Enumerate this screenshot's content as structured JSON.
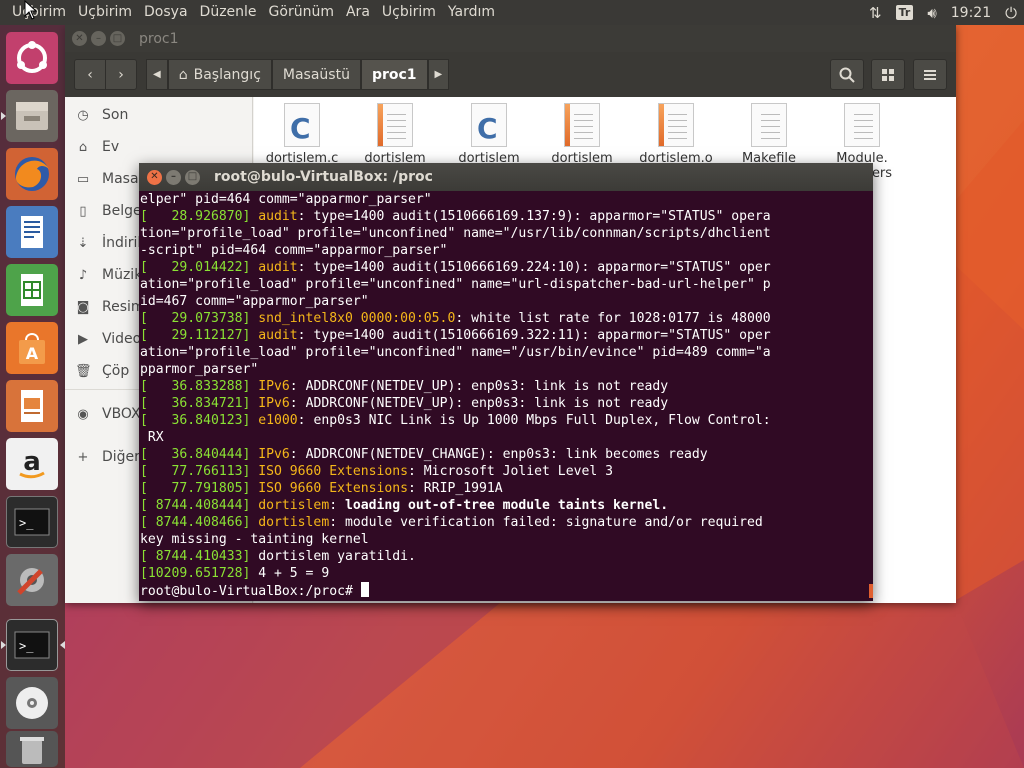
{
  "topbar": {
    "menu": [
      "Uçbirim",
      "Uçbirim",
      "Dosya",
      "Düzenle",
      "Görünüm",
      "Ara",
      "Uçbirim",
      "Yardım"
    ],
    "keyboard_layout": "Tr",
    "clock": "19:21"
  },
  "launcher": {
    "items": [
      "ubuntu-dash-icon",
      "files-icon",
      "firefox-icon",
      "writer-icon",
      "calc-icon",
      "software-center-icon",
      "impress-icon",
      "amazon-icon",
      "terminal-icon",
      "settings-icon",
      "terminal-icon",
      "dvd-icon",
      "trash-icon"
    ]
  },
  "files": {
    "window_title": "proc1",
    "breadcrumbs": [
      "Başlangıç",
      "Masaüstü",
      "proc1"
    ],
    "sidebar": [
      "Son",
      "Ev",
      "Masaüstü",
      "Belgeler",
      "İndirilenler",
      "Müzik",
      "Resimler",
      "Videolar",
      "Çöp",
      "VBOX",
      "Diğer Konumlar"
    ],
    "files": [
      "dortislem.c",
      "dortislem",
      "dortislem",
      "dortislem",
      "dortislem.o",
      "Makefile",
      "Module.symvers"
    ],
    "files_visible": [
      "dortislem.c",
      "dortislem",
      "dortislem",
      "dortislem",
      "dortislem.o",
      "Makefile",
      "Module."
    ],
    "files_second_line": [
      "",
      "",
      "",
      "",
      "",
      "",
      "ers"
    ]
  },
  "terminal": {
    "title": "root@bulo-VirtualBox: /proc",
    "prompt": "root@bulo-VirtualBox:/proc# ",
    "lines": [
      [
        {
          "t": "elper\" pid=464 comm=\"apparmor_parser\""
        }
      ],
      [
        {
          "t": "[   28.926870] ",
          "c": "ts"
        },
        {
          "t": "audit",
          "c": "sub"
        },
        {
          "t": ": type=1400 audit(1510666169.137:9): apparmor=\"STATUS\" opera"
        }
      ],
      [
        {
          "t": "tion=\"profile_load\" profile=\"unconfined\" name=\"/usr/lib/connman/scripts/dhclient"
        }
      ],
      [
        {
          "t": "-script\" pid=464 comm=\"apparmor_parser\""
        }
      ],
      [
        {
          "t": "[   29.014422] ",
          "c": "ts"
        },
        {
          "t": "audit",
          "c": "sub"
        },
        {
          "t": ": type=1400 audit(1510666169.224:10): apparmor=\"STATUS\" oper"
        }
      ],
      [
        {
          "t": "ation=\"profile_load\" profile=\"unconfined\" name=\"url-dispatcher-bad-url-helper\" p"
        }
      ],
      [
        {
          "t": "id=467 comm=\"apparmor_parser\""
        }
      ],
      [
        {
          "t": "[   29.073738] ",
          "c": "ts"
        },
        {
          "t": "snd_intel8x0 0000:00:05.0",
          "c": "sub"
        },
        {
          "t": ": white list rate for 1028:0177 is 48000"
        }
      ],
      [
        {
          "t": "[   29.112127] ",
          "c": "ts"
        },
        {
          "t": "audit",
          "c": "sub"
        },
        {
          "t": ": type=1400 audit(1510666169.322:11): apparmor=\"STATUS\" oper"
        }
      ],
      [
        {
          "t": "ation=\"profile_load\" profile=\"unconfined\" name=\"/usr/bin/evince\" pid=489 comm=\"a"
        }
      ],
      [
        {
          "t": "pparmor_parser\""
        }
      ],
      [
        {
          "t": "[   36.833288] ",
          "c": "ts"
        },
        {
          "t": "IPv6",
          "c": "sub"
        },
        {
          "t": ": ADDRCONF(NETDEV_UP): enp0s3: link is not ready"
        }
      ],
      [
        {
          "t": "[   36.834721] ",
          "c": "ts"
        },
        {
          "t": "IPv6",
          "c": "sub"
        },
        {
          "t": ": ADDRCONF(NETDEV_UP): enp0s3: link is not ready"
        }
      ],
      [
        {
          "t": "[   36.840123] ",
          "c": "ts"
        },
        {
          "t": "e1000",
          "c": "sub"
        },
        {
          "t": ": enp0s3 NIC Link is Up 1000 Mbps Full Duplex, Flow Control:"
        }
      ],
      [
        {
          "t": " RX"
        }
      ],
      [
        {
          "t": "[   36.840444] ",
          "c": "ts"
        },
        {
          "t": "IPv6",
          "c": "sub"
        },
        {
          "t": ": ADDRCONF(NETDEV_CHANGE): enp0s3: link becomes ready"
        }
      ],
      [
        {
          "t": "[   77.766113] ",
          "c": "ts"
        },
        {
          "t": "ISO 9660 Extensions",
          "c": "sub"
        },
        {
          "t": ": Microsoft Joliet Level 3"
        }
      ],
      [
        {
          "t": "[   77.791805] ",
          "c": "ts"
        },
        {
          "t": "ISO 9660 Extensions",
          "c": "sub"
        },
        {
          "t": ": RRIP_1991A"
        }
      ],
      [
        {
          "t": "[ 8744.408444] ",
          "c": "ts"
        },
        {
          "t": "dortislem",
          "c": "sub"
        },
        {
          "t": ": "
        },
        {
          "t": "loading out-of-tree module taints kernel.",
          "c": "bold"
        }
      ],
      [
        {
          "t": "[ 8744.408466] ",
          "c": "ts"
        },
        {
          "t": "dortislem",
          "c": "sub"
        },
        {
          "t": ": module verification failed: signature and/or required"
        }
      ],
      [
        {
          "t": "key missing - tainting kernel"
        }
      ],
      [
        {
          "t": "[ 8744.410433] ",
          "c": "ts"
        },
        {
          "t": "dortislem yaratildi."
        }
      ],
      [
        {
          "t": "[10209.651728] ",
          "c": "ts"
        },
        {
          "t": "4 + 5 = 9"
        }
      ]
    ]
  },
  "colors": {
    "terminal_bg": "#300a24",
    "timestamp": "#8ae234",
    "subsystem": "#f5b71a",
    "close_button": "#ef7246"
  }
}
